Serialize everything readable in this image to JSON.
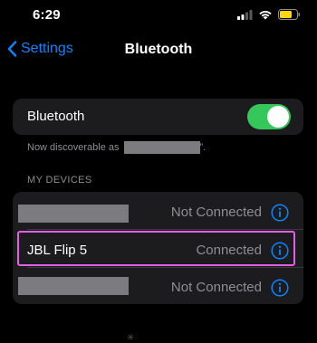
{
  "status_bar": {
    "time": "6:29",
    "icons": [
      "cellular-signal-icon",
      "wifi-icon",
      "battery-icon"
    ],
    "battery_color": "#ffd60a"
  },
  "nav": {
    "back_label": "Settings",
    "title": "Bluetooth",
    "accent_color": "#0a84ff"
  },
  "bluetooth_toggle": {
    "label": "Bluetooth",
    "state": "on",
    "on_color": "#34c759"
  },
  "discoverable": {
    "prefix": "Now discoverable as",
    "suffix": "”.",
    "device_name_redacted": true
  },
  "my_devices": {
    "header": "MY DEVICES",
    "items": [
      {
        "name": "",
        "name_redacted": true,
        "status": "Not Connected",
        "highlighted": false
      },
      {
        "name": "JBL Flip 5",
        "name_redacted": false,
        "status": "Connected",
        "highlighted": true
      },
      {
        "name": "",
        "name_redacted": true,
        "status": "Not Connected",
        "highlighted": false
      }
    ]
  },
  "highlight_color": "#e15fe3"
}
